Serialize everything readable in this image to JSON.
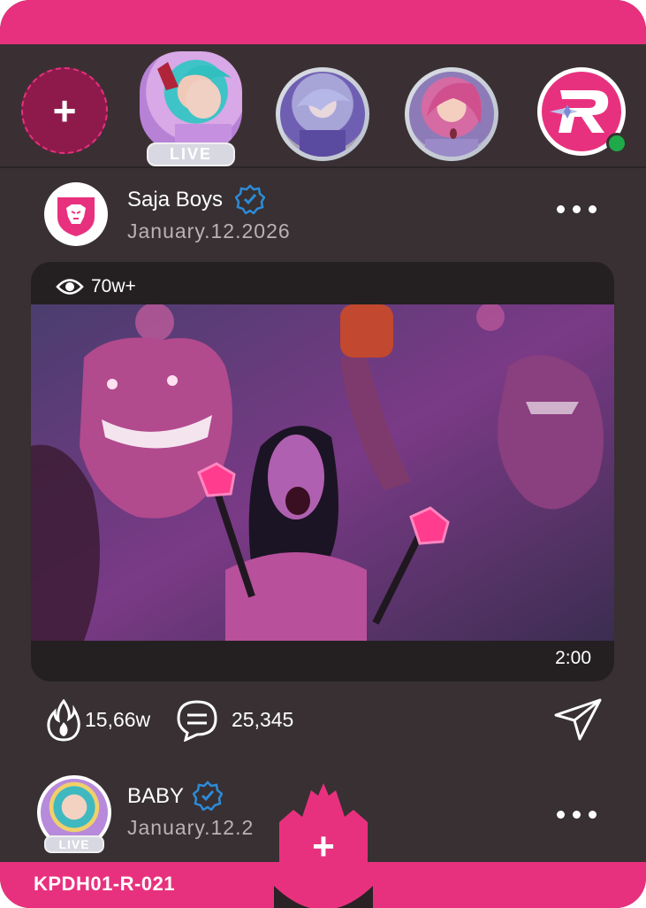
{
  "stories": {
    "add_label": "+",
    "live_label": "LIVE",
    "items": [
      {
        "name": "story-1",
        "live": true
      },
      {
        "name": "story-2",
        "live": false
      },
      {
        "name": "story-3",
        "live": false
      },
      {
        "name": "story-brand",
        "online": true
      }
    ]
  },
  "post": {
    "author": "Saja Boys",
    "date": "January.12.2026",
    "views": "70w+",
    "duration": "2:00",
    "likes": "15,66w",
    "comments": "25,345"
  },
  "next_post": {
    "author": "BABY",
    "date": "January.12.2",
    "live_label": "LIVE"
  },
  "card_code": "KPDH01-R-021",
  "fab_label": "+",
  "colors": {
    "accent": "#e8317e",
    "background": "#383032",
    "verified": "#2d8bd8",
    "online": "#1faa4a"
  },
  "icons": [
    "plus-icon",
    "verified-icon",
    "more-icon",
    "eye-icon",
    "flame-icon",
    "comment-icon",
    "send-icon",
    "brand-logo-icon"
  ]
}
